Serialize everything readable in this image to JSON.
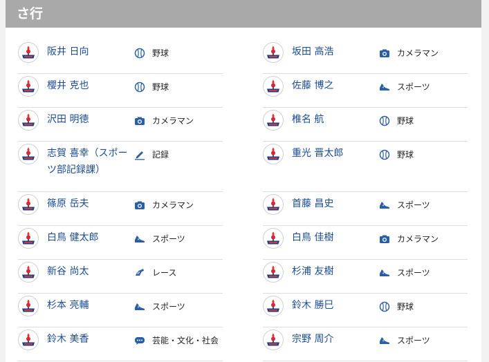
{
  "section": {
    "title": "さ行"
  },
  "colors": {
    "header_bg": "#a9a9a9",
    "name": "#1b4c94",
    "icon": "#2b5ea8"
  },
  "columns": [
    [
      {
        "name": "阪井 日向",
        "tag": "野球",
        "icon": "baseball-icon"
      },
      {
        "name": "櫻井 克也",
        "tag": "野球",
        "icon": "baseball-icon"
      },
      {
        "name": "沢田 明徳",
        "tag": "カメラマン",
        "icon": "camera-icon"
      },
      {
        "name": "志賀 喜幸（スポーツ部記録課）",
        "tag": "記録",
        "icon": "pencil-icon",
        "tall": true
      },
      {
        "name": "篠原 岳夫",
        "tag": "カメラマン",
        "icon": "camera-icon"
      },
      {
        "name": "白鳥 健太郎",
        "tag": "スポーツ",
        "icon": "shoe-icon"
      },
      {
        "name": "新谷 尚太",
        "tag": "レース",
        "icon": "horse-icon"
      },
      {
        "name": "杉本 亮輔",
        "tag": "スポーツ",
        "icon": "shoe-icon"
      },
      {
        "name": "鈴木 美香",
        "tag": "芸能・文化・社会",
        "icon": "speech-bubble-icon"
      }
    ],
    [
      {
        "name": "坂田 高浩",
        "tag": "カメラマン",
        "icon": "camera-icon"
      },
      {
        "name": "佐藤 博之",
        "tag": "スポーツ",
        "icon": "shoe-icon"
      },
      {
        "name": "椎名 航",
        "tag": "野球",
        "icon": "baseball-icon"
      },
      {
        "name": "重光 晋太郎",
        "tag": "野球",
        "icon": "baseball-icon",
        "tall": true
      },
      {
        "name": "首藤 昌史",
        "tag": "スポーツ",
        "icon": "shoe-icon"
      },
      {
        "name": "白鳥 佳樹",
        "tag": "カメラマン",
        "icon": "camera-icon"
      },
      {
        "name": "杉浦 友樹",
        "tag": "スポーツ",
        "icon": "shoe-icon"
      },
      {
        "name": "鈴木 勝巳",
        "tag": "野球",
        "icon": "baseball-icon"
      },
      {
        "name": "宗野 周介",
        "tag": "スポーツ",
        "icon": "shoe-icon"
      }
    ]
  ]
}
